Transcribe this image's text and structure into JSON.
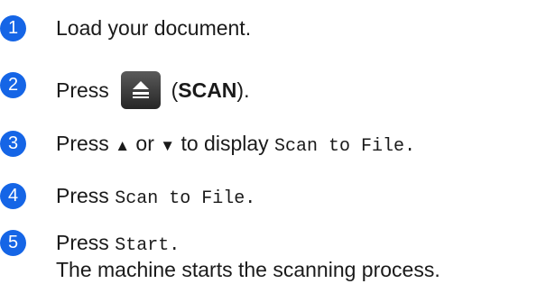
{
  "colors": {
    "badge": "#1565e6",
    "button": "#3d3d3d"
  },
  "steps": [
    {
      "number": "1",
      "text": "Load your document."
    },
    {
      "number": "2",
      "pre": "Press",
      "icon": "scan-eject-icon",
      "paren_open": "(",
      "bold": "SCAN",
      "paren_close": ")."
    },
    {
      "number": "3",
      "pre": "Press",
      "up": "▲",
      "or": "or",
      "down": "▼",
      "mid": "to display",
      "mono": "Scan to File",
      "end": "."
    },
    {
      "number": "4",
      "pre": "Press",
      "mono": "Scan to File",
      "end": "."
    },
    {
      "number": "5",
      "pre": "Press",
      "mono": "Start",
      "end": ".",
      "line2": "The machine starts the scanning process."
    }
  ]
}
